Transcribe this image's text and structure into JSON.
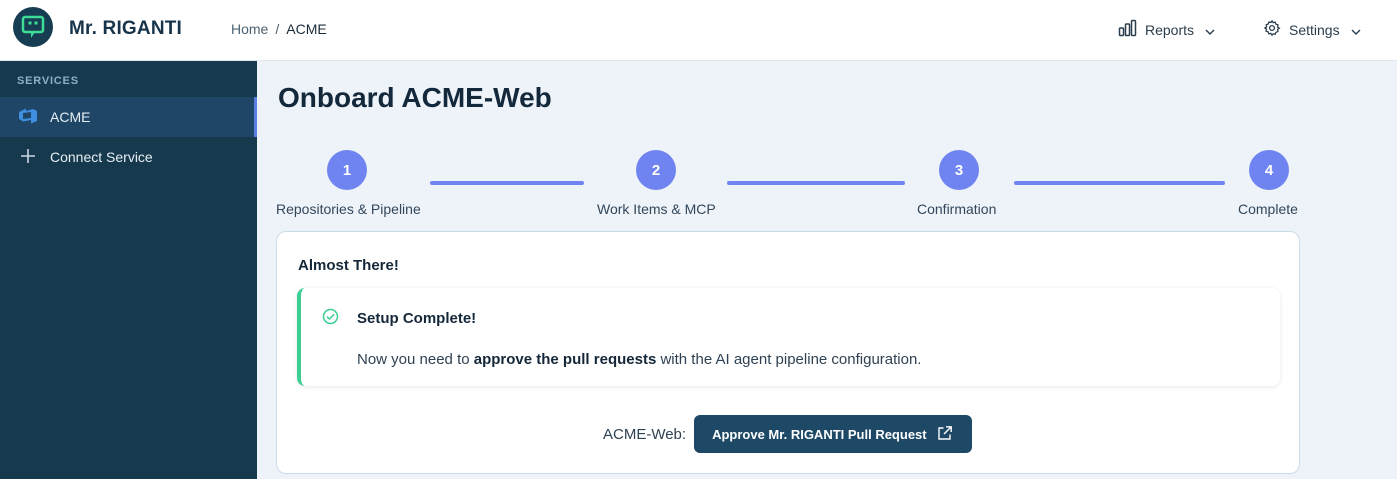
{
  "header": {
    "brand": "Mr. RIGANTI",
    "breadcrumb": {
      "home": "Home",
      "separator": "/",
      "current": "ACME"
    },
    "reports_label": "Reports",
    "settings_label": "Settings"
  },
  "sidebar": {
    "section_label": "SERVICES",
    "items": [
      {
        "label": "ACME",
        "icon": "azure-devops-icon",
        "active": true
      },
      {
        "label": "Connect Service",
        "icon": "plus-icon",
        "active": false
      }
    ]
  },
  "main": {
    "title": "Onboard ACME-Web",
    "steps": [
      {
        "number": "1",
        "label": "Repositories & Pipeline"
      },
      {
        "number": "2",
        "label": "Work Items & MCP"
      },
      {
        "number": "3",
        "label": "Confirmation"
      },
      {
        "number": "4",
        "label": "Complete"
      }
    ],
    "card": {
      "title": "Almost There!",
      "alert": {
        "title": "Setup Complete!",
        "text_before": "Now you need to ",
        "text_bold": "approve the pull requests",
        "text_after": " with the AI agent pipeline configuration."
      },
      "approve_label": "ACME-Web:",
      "approve_button": "Approve Mr. RIGANTI Pull Request"
    }
  },
  "colors": {
    "accent": "#6f84f0",
    "sidebar_bg": "#16394e",
    "success": "#3dce93",
    "button_bg": "#1d4866"
  }
}
